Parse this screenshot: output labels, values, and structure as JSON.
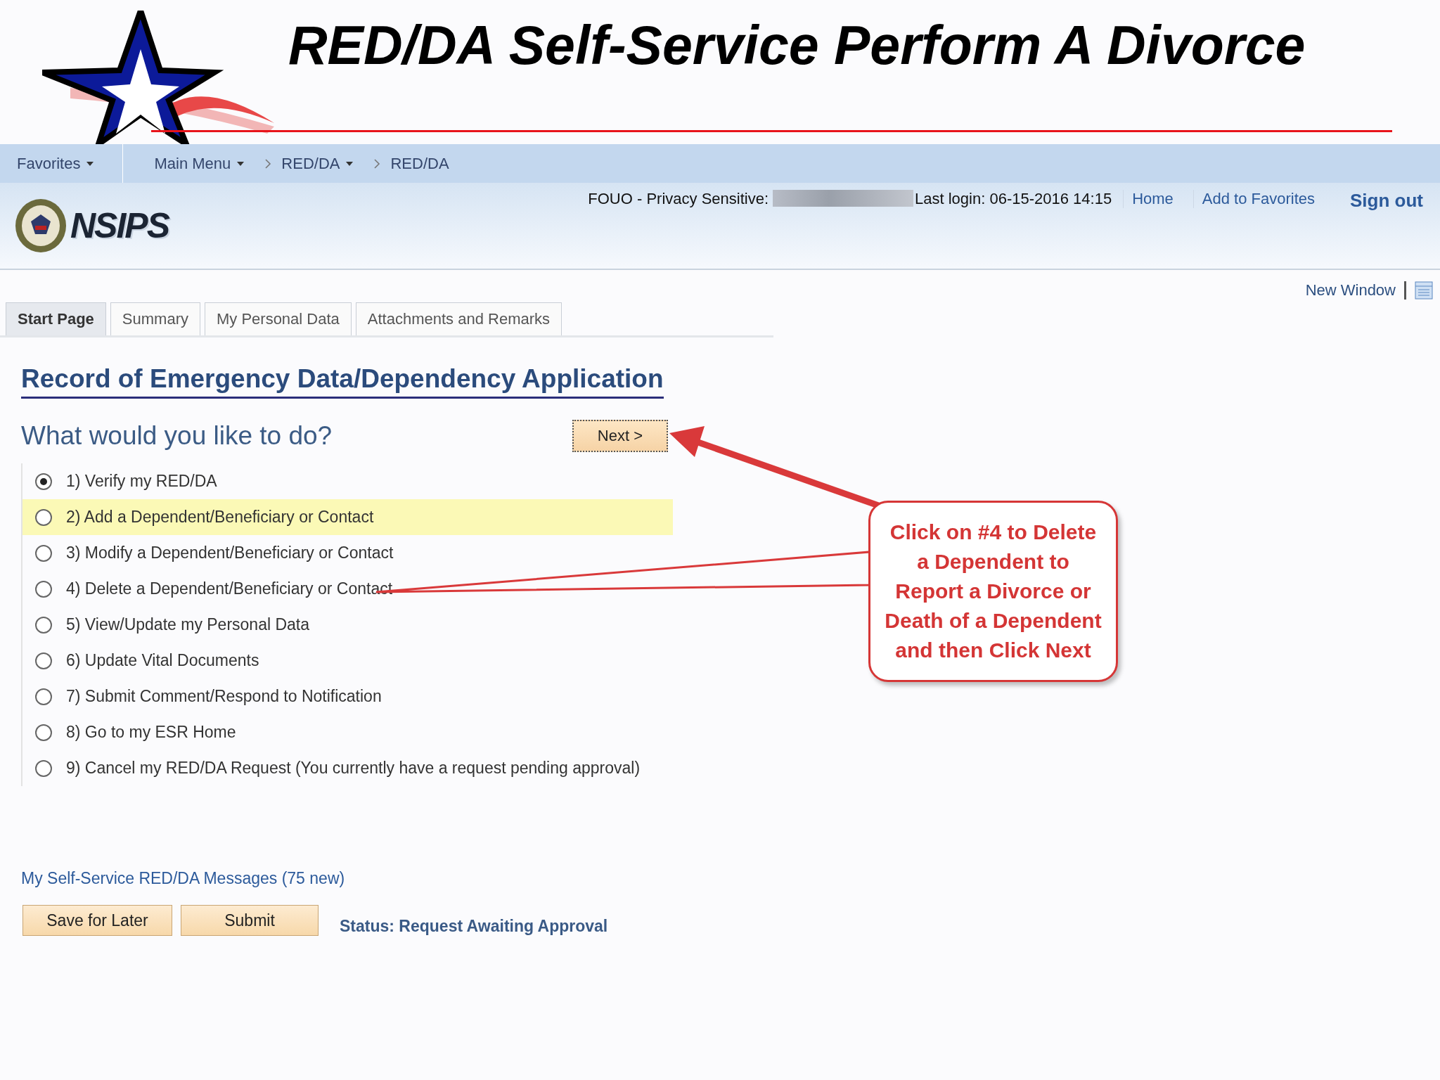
{
  "slide_title": "RED/DA Self-Service Perform A Divorce",
  "breadcrumb": [
    {
      "label": "Favorites",
      "dropdown": true,
      "separator_before": false
    },
    {
      "label": "Main Menu",
      "dropdown": true,
      "separator_before": false
    },
    {
      "label": "RED/DA",
      "dropdown": true,
      "separator_before": true
    },
    {
      "label": "RED/DA",
      "dropdown": false,
      "separator_before": true
    }
  ],
  "header": {
    "logo_text": "NSIPS",
    "privacy_label": "FOUO - Privacy Sensitive:",
    "last_login": "Last login: 06-15-2016 14:15",
    "links": [
      "Home",
      "Add to Favorites"
    ],
    "sign_out": "Sign out"
  },
  "new_window": "New Window",
  "tabs": [
    {
      "label": "Start Page",
      "selected": true
    },
    {
      "label": "Summary",
      "selected": false
    },
    {
      "label": "My Personal Data",
      "selected": false
    },
    {
      "label": "Attachments and Remarks",
      "selected": false
    }
  ],
  "heading": "Record of Emergency Data/Dependency Application",
  "question": "What would you like to do?",
  "next_button": "Next >",
  "options": [
    {
      "label": "1) Verify my RED/DA",
      "selected": true,
      "highlighted": false
    },
    {
      "label": "2) Add a Dependent/Beneficiary or Contact",
      "selected": false,
      "highlighted": true
    },
    {
      "label": "3) Modify a Dependent/Beneficiary or Contact",
      "selected": false,
      "highlighted": false
    },
    {
      "label": "4) Delete a Dependent/Beneficiary or Contact",
      "selected": false,
      "highlighted": false
    },
    {
      "label": "5) View/Update my Personal Data",
      "selected": false,
      "highlighted": false
    },
    {
      "label": "6) Update Vital Documents",
      "selected": false,
      "highlighted": false
    },
    {
      "label": "7) Submit Comment/Respond to Notification",
      "selected": false,
      "highlighted": false
    },
    {
      "label": "8) Go to my ESR Home",
      "selected": false,
      "highlighted": false
    },
    {
      "label": "9) Cancel my RED/DA Request (You currently have a request pending approval)",
      "selected": false,
      "highlighted": false
    }
  ],
  "callout": {
    "lines": [
      "Click on #4 to Delete",
      "a Dependent to",
      "Report a Divorce or",
      "Death of a Dependent",
      "and then Click Next"
    ]
  },
  "messages_link": "My Self-Service RED/DA Messages (75 new)",
  "buttons": [
    "Save for Later",
    "Submit"
  ],
  "status": "Status: Request Awaiting Approval"
}
